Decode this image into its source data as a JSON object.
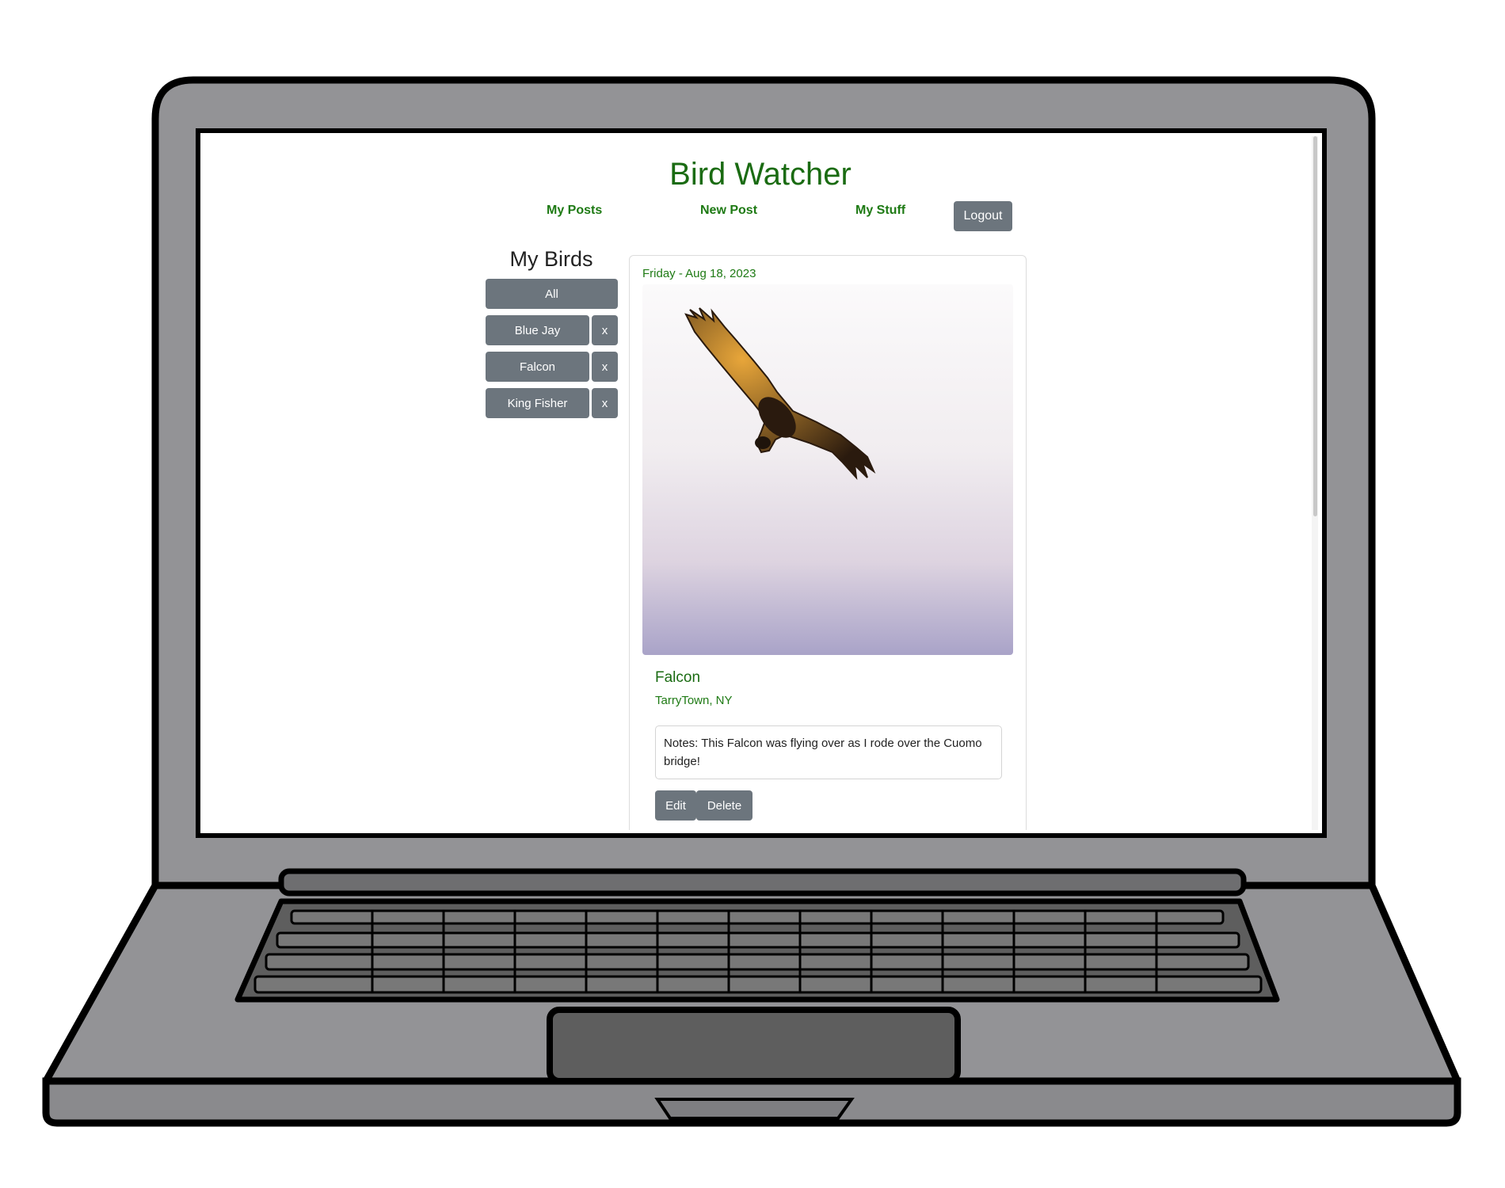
{
  "app": {
    "title": "Bird Watcher"
  },
  "nav": {
    "my_posts": "My Posts",
    "new_post": "New Post",
    "my_stuff": "My Stuff",
    "logout": "Logout"
  },
  "sidebar": {
    "title": "My Birds",
    "all_label": "All",
    "remove_label": "x",
    "birds": [
      {
        "label": "Blue Jay"
      },
      {
        "label": "Falcon"
      },
      {
        "label": "King Fisher"
      }
    ]
  },
  "post": {
    "date": "Friday - Aug 18, 2023",
    "bird": "Falcon",
    "location": "TarryTown, NY",
    "notes": "Notes: This Falcon was flying over as I rode over the Cuomo bridge!",
    "edit_label": "Edit",
    "delete_label": "Delete"
  },
  "colors": {
    "brand_green": "#1a6b12",
    "button_gray": "#6c757d",
    "laptop_body": "#939396",
    "laptop_keys": "#5e5e5e"
  },
  "icons": {
    "post_image": "soaring-falcon-photo"
  }
}
